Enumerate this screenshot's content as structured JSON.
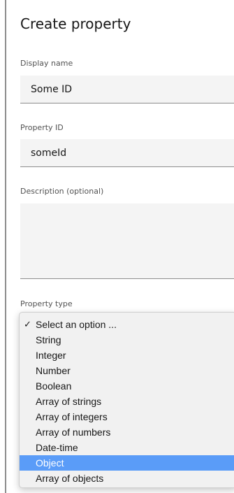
{
  "panel": {
    "title": "Create property"
  },
  "fields": {
    "display_name": {
      "label": "Display name",
      "value": "Some ID"
    },
    "property_id": {
      "label": "Property ID",
      "value": "someId"
    },
    "description": {
      "label": "Description (optional)",
      "value": ""
    },
    "property_type": {
      "label": "Property type"
    }
  },
  "dropdown": {
    "check_mark": "✓",
    "options": [
      {
        "label": "Select an option ...",
        "selected": true,
        "highlighted": false
      },
      {
        "label": "String",
        "selected": false,
        "highlighted": false
      },
      {
        "label": "Integer",
        "selected": false,
        "highlighted": false
      },
      {
        "label": "Number",
        "selected": false,
        "highlighted": false
      },
      {
        "label": "Boolean",
        "selected": false,
        "highlighted": false
      },
      {
        "label": "Array of strings",
        "selected": false,
        "highlighted": false
      },
      {
        "label": "Array of integers",
        "selected": false,
        "highlighted": false
      },
      {
        "label": "Array of numbers",
        "selected": false,
        "highlighted": false
      },
      {
        "label": "Date-time",
        "selected": false,
        "highlighted": false
      },
      {
        "label": "Object",
        "selected": false,
        "highlighted": true
      },
      {
        "label": "Array of objects",
        "selected": false,
        "highlighted": false
      }
    ]
  },
  "colors": {
    "highlight": "#5a9cf8",
    "input_background": "#f4f4f4",
    "label_text": "#525252"
  }
}
